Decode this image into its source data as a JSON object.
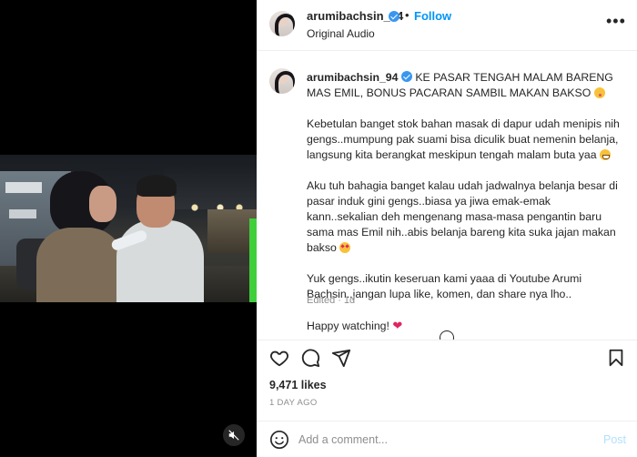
{
  "header": {
    "username": "arumibachsin_94",
    "follow_label": "Follow",
    "separator": "•",
    "audio": "Original Audio",
    "more_glyph": "•••"
  },
  "caption": {
    "username": "arumibachsin_94",
    "title": "KE PASAR TENGAH MALAM BARENG MAS EMIL, BONUS PACARAN SAMBIL MAKAN BAKSO",
    "para1": "Kebetulan banget stok bahan masak di dapur udah menipis nih gengs..mumpung pak suami bisa diculik buat nemenin belanja, langsung kita berangkat meskipun tengah malam buta yaa",
    "para2": "Aku tuh bahagia banget kalau udah jadwalnya belanja besar di pasar induk gini gengs..biasa ya jiwa emak-emak kann..sekalian deh mengenang masa-masa pengantin baru sama mas Emil nih..abis belanja bareng kita suka jajan makan bakso",
    "para3": "Yuk gengs..ikutin keseruan kami yaaa di Youtube Arumi Bachsin..jangan lupa like, komen, dan share nya lho..",
    "para4": "Happy watching!",
    "edited": "Edited",
    "dot": "·",
    "age": "1d"
  },
  "stats": {
    "likes": "9,471 likes",
    "date": "1 DAY AGO"
  },
  "comment": {
    "placeholder": "Add a comment...",
    "post_label": "Post"
  },
  "colors": {
    "accent": "#0095f6",
    "post_disabled": "#b2dffc",
    "verified": "#3897f0",
    "heart": "#e0245e"
  },
  "icons": [
    "heart-icon",
    "comment-icon",
    "share-icon",
    "bookmark-icon",
    "smile-icon",
    "mute-icon",
    "more-icon",
    "verified-icon"
  ]
}
